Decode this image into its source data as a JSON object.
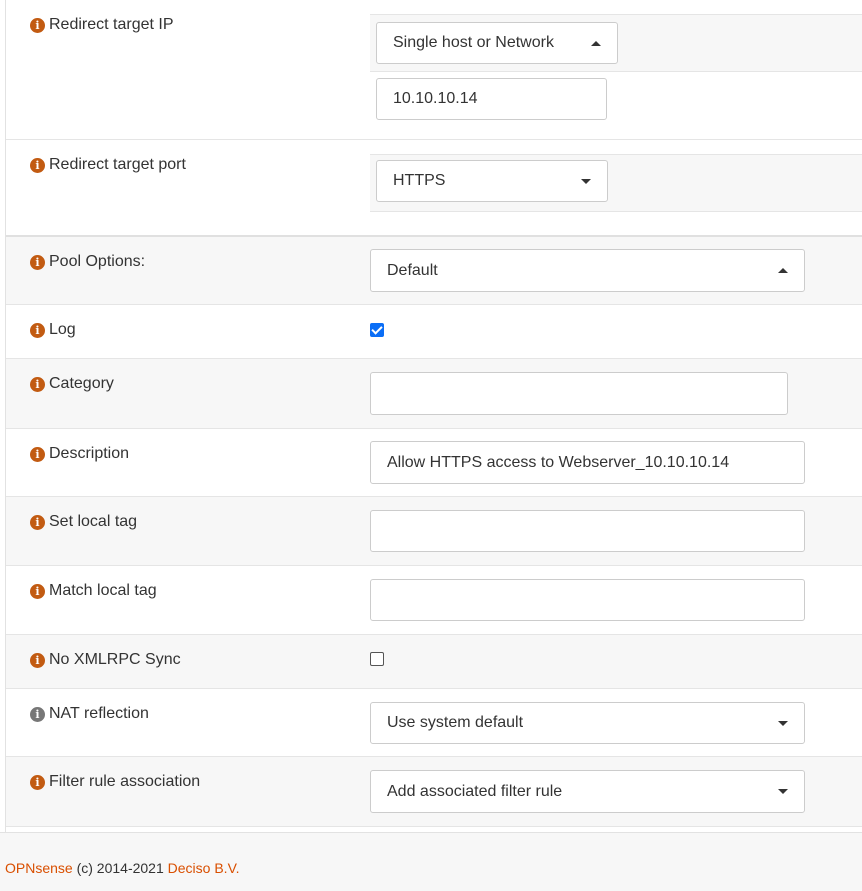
{
  "form": {
    "redirect_target_ip": {
      "label": "Redirect target IP",
      "type_select": "Single host or Network",
      "address_value": "10.10.10.14"
    },
    "redirect_target_port": {
      "label": "Redirect target port",
      "select": "HTTPS"
    },
    "pool_options": {
      "label": "Pool Options:",
      "select": "Default"
    },
    "log": {
      "label": "Log",
      "checked": true
    },
    "category": {
      "label": "Category",
      "value": ""
    },
    "description": {
      "label": "Description",
      "value": "Allow HTTPS access to Webserver_10.10.10.14"
    },
    "set_local_tag": {
      "label": "Set local tag",
      "value": ""
    },
    "match_local_tag": {
      "label": "Match local tag",
      "value": ""
    },
    "no_xmlrpc_sync": {
      "label": "No XMLRPC Sync",
      "checked": false
    },
    "nat_reflection": {
      "label": "NAT reflection",
      "select": "Use system default"
    },
    "filter_rule_association": {
      "label": "Filter rule association",
      "select": "Add associated filter rule"
    }
  },
  "footer": {
    "product": "OPNsense",
    "copyright": " (c) 2014-2021 ",
    "company": "Deciso B.V."
  },
  "colors": {
    "info_icon": "#c25b12",
    "info_icon_gray": "#777777",
    "link": "#d94f00",
    "checkbox_checked": "#0b6ef6"
  },
  "icons": {
    "info": "info-icon",
    "dropdown": "caret-down-icon",
    "dropup": "caret-up-icon"
  }
}
